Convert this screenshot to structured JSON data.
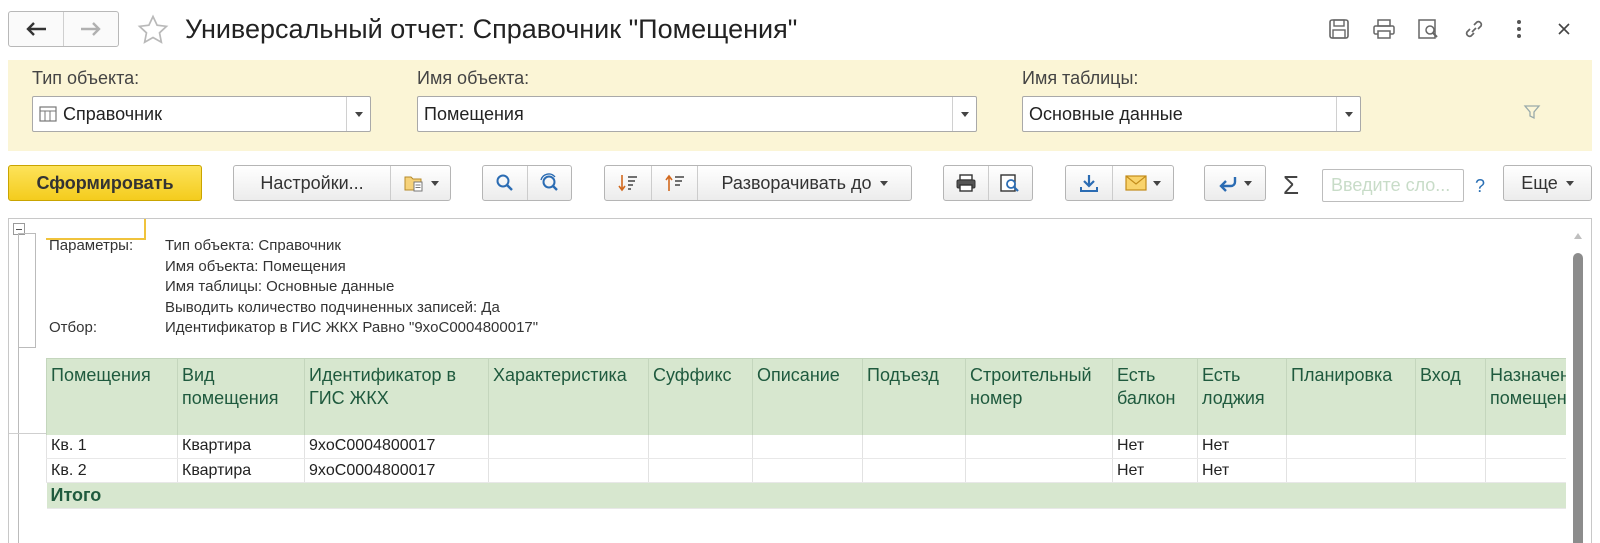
{
  "window": {
    "title": "Универсальный отчет: Справочник \"Помещения\""
  },
  "params": {
    "object_type": {
      "label": "Тип объекта:",
      "value": "Справочник"
    },
    "object_name": {
      "label": "Имя объекта:",
      "value": "Помещения"
    },
    "table_name": {
      "label": "Имя таблицы:",
      "value": "Основные данные"
    }
  },
  "toolbar": {
    "generate": "Сформировать",
    "settings": "Настройки...",
    "expand_to": "Разворачивать до",
    "search_placeholder": "Введите сло...",
    "help": "?",
    "more": "Еще",
    "sigma": "Σ"
  },
  "report": {
    "header_rows": [
      {
        "key": "Параметры:",
        "value": "Тип объекта: Справочник"
      },
      {
        "key": "",
        "value": "Имя объекта: Помещения"
      },
      {
        "key": "",
        "value": "Имя таблицы: Основные данные"
      },
      {
        "key": "",
        "value": "Выводить количество подчиненных записей: Да"
      },
      {
        "key": "Отбор:",
        "value": "Идентификатор в ГИС ЖКХ Равно \"9xoC0004800017\""
      }
    ],
    "columns": [
      "Помещения",
      "Вид помещения",
      "Идентификатор в ГИС ЖКХ",
      "Характеристика",
      "Суффикс",
      "Описание",
      "Подъезд",
      "Строительный номер",
      "Есть балкон",
      "Есть лоджия",
      "Планировка",
      "Вход",
      "Назначение помещения"
    ],
    "rows": [
      [
        "Кв. 1",
        "Квартира",
        "9xoC0004800017",
        "",
        "",
        "",
        "",
        "",
        "Нет",
        "Нет",
        "",
        "",
        ""
      ],
      [
        "Кв. 2",
        "Квартира",
        "9xoC0004800017",
        "",
        "",
        "",
        "",
        "",
        "Нет",
        "Нет",
        "",
        "",
        ""
      ]
    ],
    "total_label": "Итого"
  }
}
